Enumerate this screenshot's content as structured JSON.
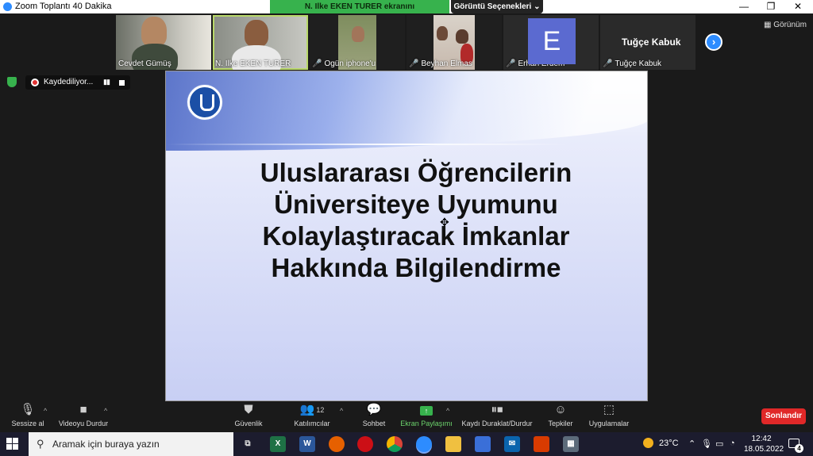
{
  "window": {
    "title": "Zoom Toplantı 40 Dakika",
    "minimize": "—",
    "restore": "❐",
    "close": "✕"
  },
  "share_banner": {
    "text": "N. Ilke EKEN TURER ekranını görüntülüyorsunuz"
  },
  "view_options": {
    "label": "Görüntü Seçenekleri",
    "caret": "⌄"
  },
  "gallery": {
    "participants": [
      {
        "name": "Cevdet Gümüş",
        "muted": false
      },
      {
        "name": "N. Ilke EKEN TURER",
        "muted": false
      },
      {
        "name": "Ogün iphone'u",
        "muted": true
      },
      {
        "name": "Beyhan Elmas",
        "muted": true
      },
      {
        "name": "Erhan Erdem",
        "muted": true,
        "avatar_letter": "E",
        "avatar_color": "#5b6ad0"
      },
      {
        "name": "Tuğçe Kabuk",
        "muted": true,
        "title_name": "Tuğçe Kabuk"
      }
    ],
    "mic_off_icon": "🎤",
    "next_icon": "›",
    "view_label": "Görünüm"
  },
  "recording": {
    "label": "Kaydediliyor...",
    "pause_icon": "▮▮"
  },
  "slide": {
    "title_lines": [
      "Uluslararası Öğrencilerin",
      "Üniversiteye Uyumunu",
      "Kolaylaştıracak İmkanlar",
      "Hakkında Bilgilendirme"
    ],
    "cursor": "✥"
  },
  "toolbar": {
    "mute": "Sessize al",
    "video": "Videoyu Durdur",
    "security": "Güvenlik",
    "participants": "Katılımcılar",
    "participants_count": "12",
    "chat": "Sohbet",
    "share": "Ekran Paylaşımı",
    "record": "Kaydı Duraklat/Durdur",
    "reactions": "Tepkiler",
    "apps": "Uygulamalar",
    "end": "Sonlandır",
    "caret": "^"
  },
  "taskbar": {
    "search_placeholder": "Aramak için buraya yazın",
    "weather": "23°C",
    "time": "12:42",
    "date": "18.05.2022",
    "notifications": "4"
  }
}
